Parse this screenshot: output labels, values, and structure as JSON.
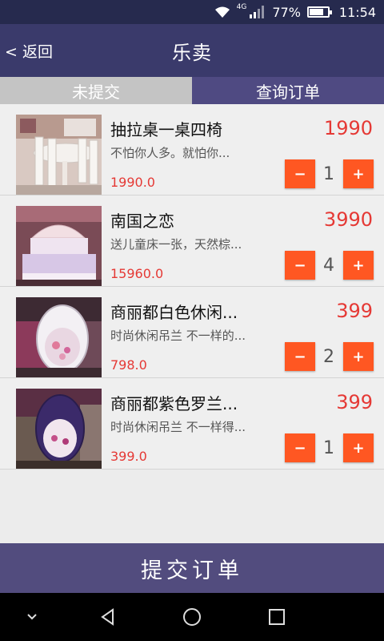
{
  "status_bar": {
    "network": "4G",
    "battery_text": "77%",
    "battery_level": 0.77,
    "time": "11:54",
    "icons": [
      "wifi-icon",
      "signal-icon",
      "battery-icon"
    ]
  },
  "header": {
    "back_label": "< 返回",
    "title": "乐卖"
  },
  "tabs": [
    {
      "label": "未提交",
      "active": false
    },
    {
      "label": "查询订单",
      "active": true
    }
  ],
  "items": [
    {
      "name": "抽拉桌一桌四椅",
      "description": "不怕你人多。就怕你...",
      "price": "1990",
      "quantity": "1",
      "subtotal": "1990.0",
      "image": "dining-set-image"
    },
    {
      "name": "南国之恋",
      "description": "送儿童床一张，天然棕...",
      "price": "3990",
      "quantity": "4",
      "subtotal": "15960.0",
      "image": "bed-image"
    },
    {
      "name": "商丽都白色休闲...",
      "description": "时尚休闲吊兰 不一样的...",
      "price": "399",
      "quantity": "2",
      "subtotal": "798.0",
      "image": "white-hanging-chair-image"
    },
    {
      "name": "商丽都紫色罗兰...",
      "description": "时尚休闲吊兰 不一样得...",
      "price": "399",
      "quantity": "1",
      "subtotal": "399.0",
      "image": "purple-hanging-chair-image"
    }
  ],
  "buttons": {
    "minus": "−",
    "plus": "+"
  },
  "footer": {
    "submit_label": "提交订单"
  },
  "colors": {
    "accent": "#ff5722",
    "price_red": "#e53935",
    "header_bg": "#3a3a6b",
    "tab_active": "#4f4a82",
    "submit_bg": "#524c7e"
  }
}
